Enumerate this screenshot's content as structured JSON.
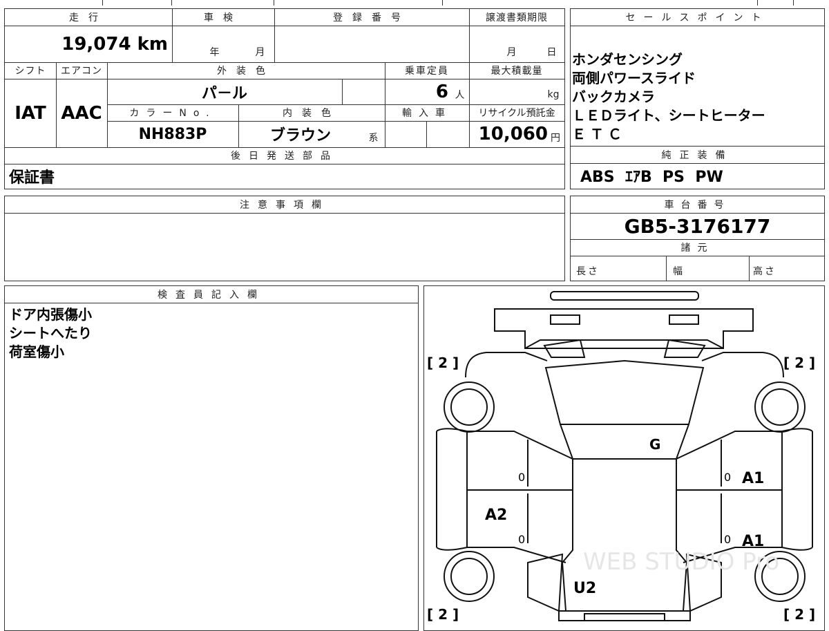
{
  "top": {
    "mileage_label": "走行",
    "mileage_value": "19,074 km",
    "inspection_label": "車検",
    "inspection_year": "年",
    "inspection_month": "月",
    "registration_label": "登録番号",
    "transfer_deadline_label": "譲渡書類期限",
    "transfer_month": "月",
    "transfer_day": "日",
    "shift_label": "シフト",
    "shift_value": "IAT",
    "ac_label": "エアコン",
    "ac_value": "AAC",
    "exterior_color_label": "外装色",
    "exterior_color_value": "パ－ル",
    "capacity_label": "乗車定員",
    "capacity_value": "6",
    "capacity_unit": "人",
    "max_load_label": "最大積載量",
    "max_load_unit": "kg",
    "color_no_label": "カラーNo.",
    "color_no_value": "NH883P",
    "interior_color_label": "内装色",
    "interior_color_value": "ブラウン",
    "interior_color_suffix": "系",
    "import_label": "輸入車",
    "recycle_label": "リサイクル預託金",
    "recycle_value": "10,060",
    "recycle_unit": "円",
    "later_parts_label": "後日発送部品",
    "later_parts_value": "保証書"
  },
  "sales_points": {
    "label": "セールスポイント",
    "lines": [
      "ホンダセンシング",
      "両側パワースライド",
      "バックカメラ",
      "ＬＥＤライト、シートヒーター",
      "ＥＴＣ"
    ]
  },
  "equipment": {
    "label": "純正装備",
    "value": "ABS  ｴｱB  PS  PW"
  },
  "notes": {
    "label": "注意事項欄"
  },
  "chassis": {
    "label": "車台番号",
    "value": "GB5-3176177"
  },
  "specs": {
    "label": "諸元",
    "length": "長さ",
    "width": "幅",
    "height": "高さ"
  },
  "inspector": {
    "label": "検査員記入欄",
    "lines": [
      "ドア内張傷小",
      "シートへたり",
      "荷室傷小"
    ]
  },
  "diagram": {
    "tire_fl": "[ 2 ]",
    "tire_fr": "[ 2 ]",
    "tire_rl": "[ 2 ]",
    "tire_rr": "[ 2 ]",
    "marks": {
      "windshield": "G",
      "right_front_door": "A1",
      "right_rear_door": "A1",
      "left_rear_door": "A2",
      "rear": "U2",
      "zero_a": "0",
      "zero_b": "0",
      "zero_c": "0",
      "zero_d": "0"
    },
    "watermark": "WEB STUDIO Pro"
  }
}
